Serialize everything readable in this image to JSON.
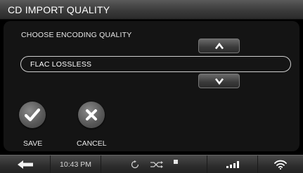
{
  "header": {
    "title": "CD IMPORT QUALITY"
  },
  "dialog": {
    "prompt": "CHOOSE ENCODING QUALITY",
    "selected_value": "FLAC LOSSLESS",
    "up_icon": "chevron-up-icon",
    "down_icon": "chevron-down-icon"
  },
  "actions": {
    "save_label": "SAVE",
    "cancel_label": "CANCEL",
    "save_icon": "checkmark-icon",
    "cancel_icon": "close-icon"
  },
  "status_bar": {
    "time": "10:43 PM",
    "icons": [
      "back-arrow-icon",
      "repeat-icon",
      "shuffle-icon",
      "stop-icon",
      "signal-strength-icon",
      "wifi-icon"
    ]
  }
}
